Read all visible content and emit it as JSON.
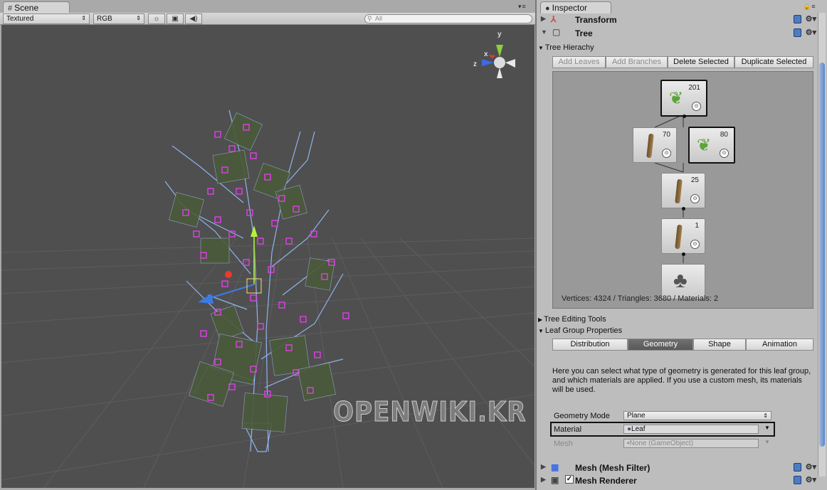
{
  "scene": {
    "tab_label": "Scene",
    "tab_icon": "#",
    "toolbar": {
      "render_mode": "Textured",
      "color_mode": "RGB",
      "lighting_icon": "☼",
      "image_icon": "▣",
      "audio_icon": "◀)"
    },
    "search_placeholder": "All",
    "gizmo": {
      "x": "x",
      "y": "y",
      "z": "z"
    },
    "watermark": "OPENWIKI.KR"
  },
  "inspector": {
    "tab_label": "Inspector",
    "tab_icon": "●",
    "components": {
      "transform": "Transform",
      "tree": "Tree",
      "mesh_filter": "Mesh (Mesh Filter)",
      "mesh_renderer": "Mesh Renderer"
    },
    "tree_hierarchy": {
      "title": "Tree Hierachy",
      "buttons": [
        "Add Leaves",
        "Add Branches",
        "Delete Selected",
        "Duplicate Selected"
      ],
      "nodes": [
        {
          "type": "leaf",
          "count": "201",
          "selected": true
        },
        {
          "type": "branch",
          "count": "70",
          "selected": false
        },
        {
          "type": "leaf",
          "count": "80",
          "selected": true
        },
        {
          "type": "branch",
          "count": "25",
          "selected": false
        },
        {
          "type": "branch",
          "count": "1",
          "selected": false
        },
        {
          "type": "root",
          "count": "",
          "selected": false
        }
      ],
      "stats": "Vertices: 4324 / Triangles: 3680 / Materials: 2"
    },
    "tree_editing_tools": "Tree Editing Tools",
    "leaf_group": {
      "title": "Leaf Group Properties",
      "tabs": [
        "Distribution",
        "Geometry",
        "Shape",
        "Animation"
      ],
      "active_tab": "Geometry",
      "description": "Here you can select what type of geometry is generated for this leaf group, and which materials are applied. If you use a custom mesh, its materials will be used.",
      "geometry_mode_label": "Geometry Mode",
      "geometry_mode_value": "Plane",
      "material_label": "Material",
      "material_value": "Leaf",
      "mesh_label": "Mesh",
      "mesh_value": "None (GameObject)"
    }
  }
}
